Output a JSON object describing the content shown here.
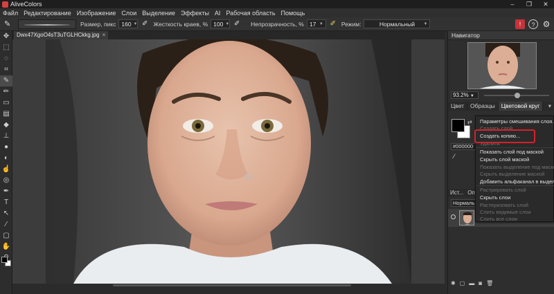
{
  "window": {
    "title": "AliveColors",
    "controls": [
      "–",
      "❐",
      "✕"
    ]
  },
  "menu": [
    "Файл",
    "Редактирование",
    "Изображение",
    "Слои",
    "Выделение",
    "Эффекты",
    "AI",
    "Рабочая область",
    "Помощь"
  ],
  "options": {
    "size_label": "Размер, пикс",
    "size_value": "160",
    "hardness_label": "Жесткость краев, %",
    "hardness_value": "100",
    "opacity_label": "Непрозрачность, %",
    "opacity_value": "17",
    "mode_label": "Режим:",
    "mode_value": "Нормальный"
  },
  "document": {
    "tab_name": "Dwx47XgoO4sT3uTGLHCkkg.jpg",
    "close": "×"
  },
  "navigator": {
    "title": "Навигатор",
    "zoom": "93.2%"
  },
  "color_panel": {
    "tabs": [
      "Цвет",
      "Образцы",
      "Цветовой круг"
    ],
    "hex": "#000000"
  },
  "layers_panel": {
    "tabs": [
      "Ист...",
      "Оп"
    ],
    "blend": "Нормаль"
  },
  "context_menu": {
    "items": [
      {
        "label": "Параметры смешивания слоя...",
        "enabled": true
      },
      {
        "label": "Создать слой",
        "enabled": false
      },
      {
        "label": "Создать копию...",
        "enabled": true,
        "highlighted": true
      },
      {
        "label": "Удалить",
        "enabled": false
      },
      {
        "label": "Показать слой под маской",
        "enabled": true
      },
      {
        "label": "Скрыть слой маской",
        "enabled": true
      },
      {
        "label": "Показать выделение под маской",
        "enabled": false
      },
      {
        "label": "Скрыть выделение маской",
        "enabled": false
      },
      {
        "label": "Добавить альфаканал в выделение",
        "enabled": true
      },
      {
        "label": "Растрировать слой",
        "enabled": false
      },
      {
        "label": "Скрыть слои",
        "enabled": true
      },
      {
        "label": "Растеризовать слой",
        "enabled": false
      },
      {
        "label": "Слить видимые слои",
        "enabled": false
      },
      {
        "label": "Слить все слои",
        "enabled": false
      }
    ],
    "highlight_color": "#d8202a"
  },
  "colors": {
    "accent": "#d8202a",
    "panel_bg": "#2e2e2e",
    "canvas_bg": "#3c3c3c"
  },
  "icons": {
    "tools": [
      "brush-icon",
      "marquee-icon",
      "lasso-icon",
      "crop-icon",
      "brush-tool-icon",
      "pencil-icon",
      "eraser-icon",
      "gradient-icon",
      "fill-icon",
      "stamp-icon",
      "blur-icon",
      "dodge-icon",
      "smudge-icon",
      "text-icon",
      "pen-icon",
      "shape-icon",
      "eyedropper-icon",
      "hand-icon",
      "zoom-icon"
    ]
  }
}
